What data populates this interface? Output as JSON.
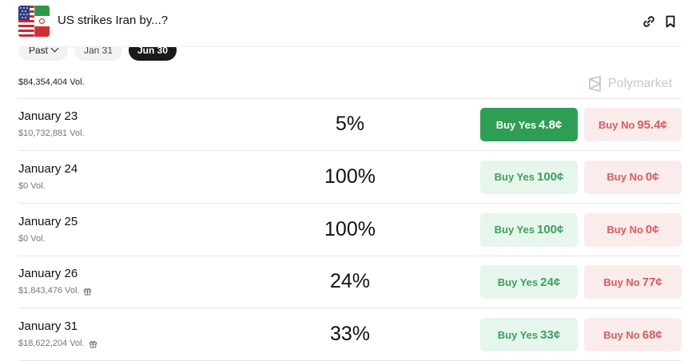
{
  "header": {
    "title": "US strikes Iran by...?",
    "flag_icon": "us-iran-flag-icon",
    "link_icon": "link-icon",
    "bookmark_icon": "bookmark-icon"
  },
  "filters": {
    "past_label": "Past",
    "pill_jan31": "Jan 31",
    "pill_jun30": "Jun 30"
  },
  "summary": {
    "total_volume": "$84,354,404 Vol.",
    "brand": "Polymarket"
  },
  "colors": {
    "yes_active_bg": "#2f9e55",
    "yes_bg": "#e6f6ec",
    "yes_text": "#3d9e60",
    "no_bg": "#fbecec",
    "no_text": "#e05858"
  },
  "markets": [
    {
      "date": "January 23",
      "volume": "$10,732,881 Vol.",
      "gift": false,
      "chance": "5%",
      "yes_label": "Buy Yes",
      "yes_price": "4.8¢",
      "no_label": "Buy No",
      "no_price": "95.4¢",
      "yes_active": true
    },
    {
      "date": "January 24",
      "volume": "$0 Vol.",
      "gift": false,
      "chance": "100%",
      "yes_label": "Buy Yes",
      "yes_price": "100¢",
      "no_label": "Buy No",
      "no_price": "0¢",
      "yes_active": false
    },
    {
      "date": "January 25",
      "volume": "$0 Vol.",
      "gift": false,
      "chance": "100%",
      "yes_label": "Buy Yes",
      "yes_price": "100¢",
      "no_label": "Buy No",
      "no_price": "0¢",
      "yes_active": false
    },
    {
      "date": "January 26",
      "volume": "$1,843,476 Vol.",
      "gift": true,
      "chance": "24%",
      "yes_label": "Buy Yes",
      "yes_price": "24¢",
      "no_label": "Buy No",
      "no_price": "77¢",
      "yes_active": false
    },
    {
      "date": "January 31",
      "volume": "$18,622,204 Vol.",
      "gift": true,
      "chance": "33%",
      "yes_label": "Buy Yes",
      "yes_price": "33¢",
      "no_label": "Buy No",
      "no_price": "68¢",
      "yes_active": false
    }
  ]
}
